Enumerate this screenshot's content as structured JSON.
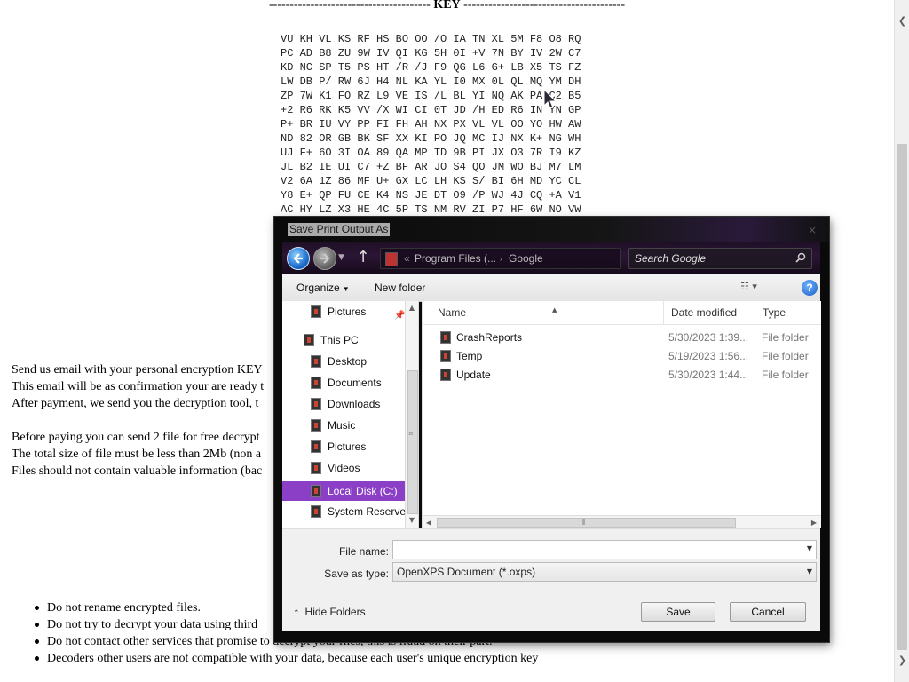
{
  "page": {
    "key_title_left": "--------------------------------------- ",
    "key_title_word": "KEY",
    "key_title_right": " ---------------------------------------",
    "key_rows": [
      "VU KH VL KS RF HS BO OO /O IA TN XL 5M F8 O8 RQ",
      "PC AD B8 ZU 9W IV QI KG 5H 0I +V 7N BY IV 2W C7",
      "KD NC SP T5 PS HT /R /J F9 QG L6 G+ LB X5 TS FZ",
      "LW DB P/ RW 6J H4 NL KA YL I0 MX 0L QL MQ YM DH",
      "ZP 7W K1 FO RZ L9 VE IS /L BL YI NQ AK PA C2 B5",
      "+2 R6 RK K5 VV /X WI CI 0T JD /H ED R6 IN YN GP",
      "P+ BR IU VY PP FI FH AH NX PX VL VL OO YO HW AW",
      "ND 82 OR GB BK SF XX KI PO JQ MC IJ NX K+ NG WH",
      "UJ F+ 6O 3I OA 89 QA MP TD 9B PI JX O3 7R I9 KZ",
      "JL B2 IE UI C7 +Z BF AR JO S4 QO JM WO BJ M7 LM",
      "V2 6A 1Z 86 MF U+ GX LC LH KS S/ BI 6H MD YC CL",
      "Y8 E+ QP FU CE K4 NS JE DT O9 /P WJ 4J CQ +A V1",
      "AC HY LZ X3 HE 4C 5P TS NM RV ZI P7 HF 6W NO VW"
    ],
    "paragraph_lines": [
      "Send us email with your personal encryption KEY",
      "This email will be as confirmation your are ready t",
      "After payment, we send you the decryption tool, t",
      "",
      "Before paying you can send 2 file for free decrypt",
      "The total size of file must be less than 2Mb (non a",
      "Files should not contain valuable information (bac"
    ],
    "rules": [
      "Do not rename encrypted files.",
      "Do not try to decrypt your data using third",
      "Do not contact other services that promise to decrypt your files, this is fraud on their part.",
      "Decoders other users are not compatible with your data, because each user's unique encryption key"
    ]
  },
  "dialog": {
    "title": "Save Print Output As",
    "close_glyph": "×",
    "address": {
      "overflow": "«",
      "segments": [
        "Program Files (...",
        "Google"
      ],
      "separator": "›"
    },
    "search_placeholder": "Search Google",
    "toolbar": {
      "organize_label": "Organize",
      "new_folder_label": "New folder",
      "view_glyph": "☷ ▾",
      "help_glyph": "?"
    },
    "nav_items": [
      {
        "label": "Pictures",
        "indent": 2,
        "pinned": true,
        "selected": false,
        "icon": "pictures-folder-icon"
      },
      {
        "label": "This PC",
        "indent": 1,
        "pinned": false,
        "selected": false,
        "icon": "computer-icon"
      },
      {
        "label": "Desktop",
        "indent": 2,
        "pinned": false,
        "selected": false,
        "icon": "desktop-folder-icon"
      },
      {
        "label": "Documents",
        "indent": 2,
        "pinned": false,
        "selected": false,
        "icon": "documents-folder-icon"
      },
      {
        "label": "Downloads",
        "indent": 2,
        "pinned": false,
        "selected": false,
        "icon": "downloads-folder-icon"
      },
      {
        "label": "Music",
        "indent": 2,
        "pinned": false,
        "selected": false,
        "icon": "music-folder-icon"
      },
      {
        "label": "Pictures",
        "indent": 2,
        "pinned": false,
        "selected": false,
        "icon": "pictures-folder-icon"
      },
      {
        "label": "Videos",
        "indent": 2,
        "pinned": false,
        "selected": false,
        "icon": "videos-folder-icon"
      },
      {
        "label": "Local Disk (C:)",
        "indent": 2,
        "pinned": false,
        "selected": true,
        "icon": "drive-icon"
      },
      {
        "label": "System Reserved",
        "indent": 2,
        "pinned": false,
        "selected": false,
        "icon": "drive-icon"
      }
    ],
    "columns": {
      "name": "Name",
      "date": "Date modified",
      "type": "Type"
    },
    "files": [
      {
        "name": "CrashReports",
        "date": "5/30/2023 1:39...",
        "type": "File folder"
      },
      {
        "name": "Temp",
        "date": "5/19/2023 1:56...",
        "type": "File folder"
      },
      {
        "name": "Update",
        "date": "5/30/2023 1:44...",
        "type": "File folder"
      }
    ],
    "file_name_label": "File name:",
    "file_name_value": "",
    "save_type_label": "Save as type:",
    "save_type_value": "OpenXPS Document (*.oxps)",
    "hide_folders_label": "Hide Folders",
    "save_label": "Save",
    "cancel_label": "Cancel"
  },
  "colors": {
    "selection": "#8a3fc6",
    "nav_accent": "#8a2fb3"
  }
}
